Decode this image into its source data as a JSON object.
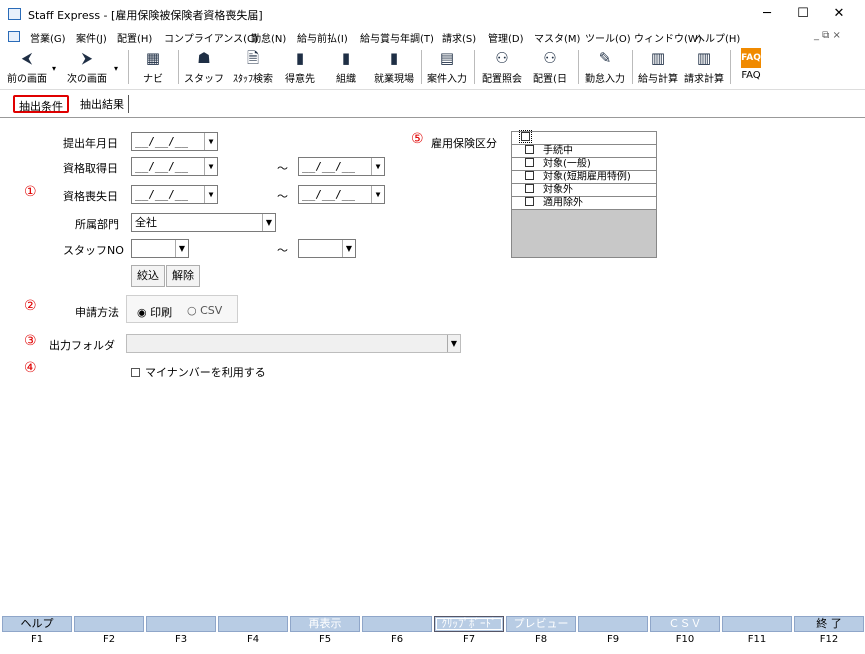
{
  "window": {
    "title": "Staff Express - [雇用保険被保険者資格喪失届]",
    "minimize": "─",
    "maximize": "☐",
    "close": "✕"
  },
  "menu": {
    "items": [
      "営業(G)",
      "案件(J)",
      "配置(H)",
      "コンプライアンス(C)",
      "勤怠(N)",
      "給与前払(I)",
      "給与賞与年調(T)",
      "請求(S)",
      "管理(D)",
      "マスタ(M)",
      "ツール(O)",
      "ウィンドウ(W)",
      "ヘルプ(H)"
    ],
    "restore": "_ ⧉ ×"
  },
  "toolbar": {
    "prev": "前の画面",
    "next": "次の画面",
    "navi": "ナビ",
    "staff": "スタッフ",
    "staff_search": "ｽﾀｯﾌ検索",
    "client": "得意先",
    "org": "組織",
    "worksite": "就業現場",
    "case_entry": "案件入力",
    "assign_inquiry": "配置照会",
    "assign_day": "配置(日",
    "attendance_entry": "勤怠入力",
    "payroll_calc": "給与計算",
    "billing_calc": "請求計算",
    "faq": "FAQ"
  },
  "tabs": {
    "conditions": "抽出条件",
    "results": "抽出結果"
  },
  "form": {
    "submit_date_label": "提出年月日",
    "submit_date_value": "__/__/__",
    "acquire_date_label": "資格取得日",
    "acquire_from": "__/__/__",
    "acquire_to": "__/__/__",
    "loss_date_label": "資格喪失日",
    "loss_from": "__/__/__",
    "loss_to": "__/__/__",
    "range_sep": "～",
    "dept_label": "所属部門",
    "dept_value": "全社",
    "staffno_label": "スタッフNO",
    "narrow_btn": "絞込",
    "clear_btn": "解除",
    "method_label": "申請方法",
    "method_print": "印刷",
    "method_csv": "CSV",
    "folder_label": "出力フォルダ",
    "mynumber_label": "マイナンバーを利用する",
    "insurance_label": "雇用保険区分",
    "insurance_items": [
      "",
      "手続中",
      "対象(一般)",
      "対象(短期雇用特例)",
      "対象外",
      "適用除外"
    ]
  },
  "markers": {
    "m1": "①",
    "m2": "②",
    "m3": "③",
    "m4": "④",
    "m5": "⑤"
  },
  "fkeys": {
    "labels": [
      "ヘルプ",
      "",
      "",
      "",
      "再表示",
      "",
      "ｸﾘｯﾌﾟﾎﾞｰﾄﾞ",
      "プレビュー",
      "",
      "ＣＳＶ",
      "",
      "終 了"
    ],
    "numbers": [
      "F1",
      "F2",
      "F3",
      "F4",
      "F5",
      "F6",
      "F7",
      "F8",
      "F9",
      "F10",
      "F11",
      "F12"
    ]
  },
  "colors": {
    "accent_red": "#e00000",
    "fkey_bg": "#b8cce4"
  }
}
